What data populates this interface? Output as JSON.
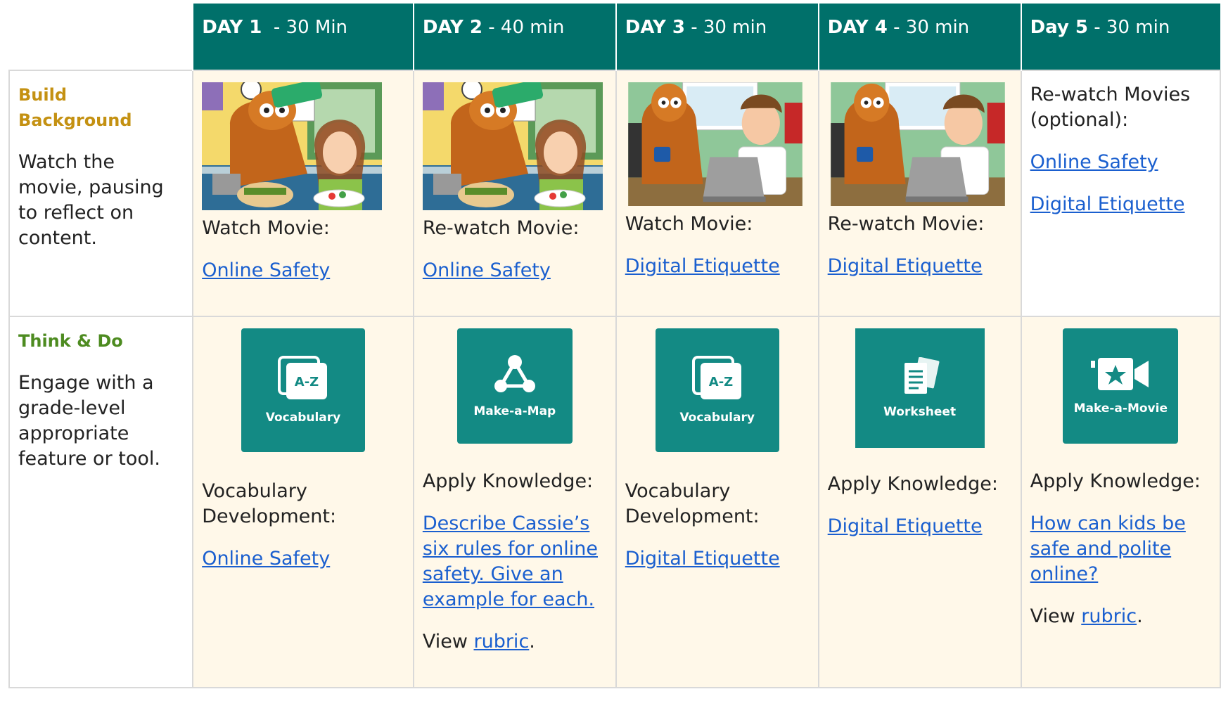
{
  "header": {
    "days": [
      {
        "day": "DAY 1",
        "duration": "  - 30 Min"
      },
      {
        "day": "DAY 2",
        "duration": " - 40 min"
      },
      {
        "day": "DAY 3",
        "duration": " - 30 min"
      },
      {
        "day": "DAY 4",
        "duration": " - 30 min"
      },
      {
        "day": "Day 5",
        "duration": " - 30 min"
      }
    ]
  },
  "rows": {
    "build_background": {
      "title": "Build Background",
      "description": "Watch the movie, pausing to reflect on content.",
      "title_color": "#c49112",
      "cells": [
        {
          "label": "Watch Movie:",
          "link": "Online Safety",
          "thumbnail": "online-safety-movie-thumbnail"
        },
        {
          "label": "Re-watch Movie:",
          "link": "Online Safety",
          "thumbnail": "online-safety-movie-thumbnail"
        },
        {
          "label": "Watch Movie:",
          "link": "Digital Etiquette",
          "thumbnail": "digital-etiquette-movie-thumbnail"
        },
        {
          "label": "Re-watch Movie:",
          "link": "Digital Etiquette",
          "thumbnail": "digital-etiquette-movie-thumbnail"
        },
        {
          "label": "Re-watch Movies (optional):",
          "links": [
            "Online Safety",
            "Digital Etiquette"
          ]
        }
      ]
    },
    "think_and_do": {
      "title": "Think & Do",
      "description": "Engage with a grade-level appropriate feature or tool.",
      "title_color": "#4d8b20",
      "cells": [
        {
          "tool": "Vocabulary",
          "tool_icon": "a-z-cards-icon",
          "tool_icon_text": "A-Z",
          "label": "Vocabulary Development:",
          "link": "Online Safety"
        },
        {
          "tool": "Make-a-Map",
          "tool_icon": "concept-map-icon",
          "label": "Apply Knowledge:",
          "link": "Describe Cassie’s six rules for online safety. Give an example for each.",
          "view_prefix": "View ",
          "view_link": "rubric",
          "view_suffix": "."
        },
        {
          "tool": "Vocabulary",
          "tool_icon": "a-z-cards-icon",
          "tool_icon_text": "A-Z",
          "label": "Vocabulary Development:",
          "link": "Digital Etiquette"
        },
        {
          "tool": "Worksheet",
          "tool_icon": "worksheet-icon",
          "label": "Apply Knowledge:",
          "link": "Digital Etiquette"
        },
        {
          "tool": "Make-a-Movie",
          "tool_icon": "movie-camera-star-icon",
          "label": "Apply Knowledge:",
          "link": "How can kids be safe and polite online?",
          "view_prefix": "View ",
          "view_link": "rubric",
          "view_suffix": "."
        }
      ]
    }
  },
  "colors": {
    "header_bg": "#00706a",
    "tool_bg": "#138a84",
    "cell_bg": "#fff8e9",
    "link": "#1a5fcf"
  }
}
